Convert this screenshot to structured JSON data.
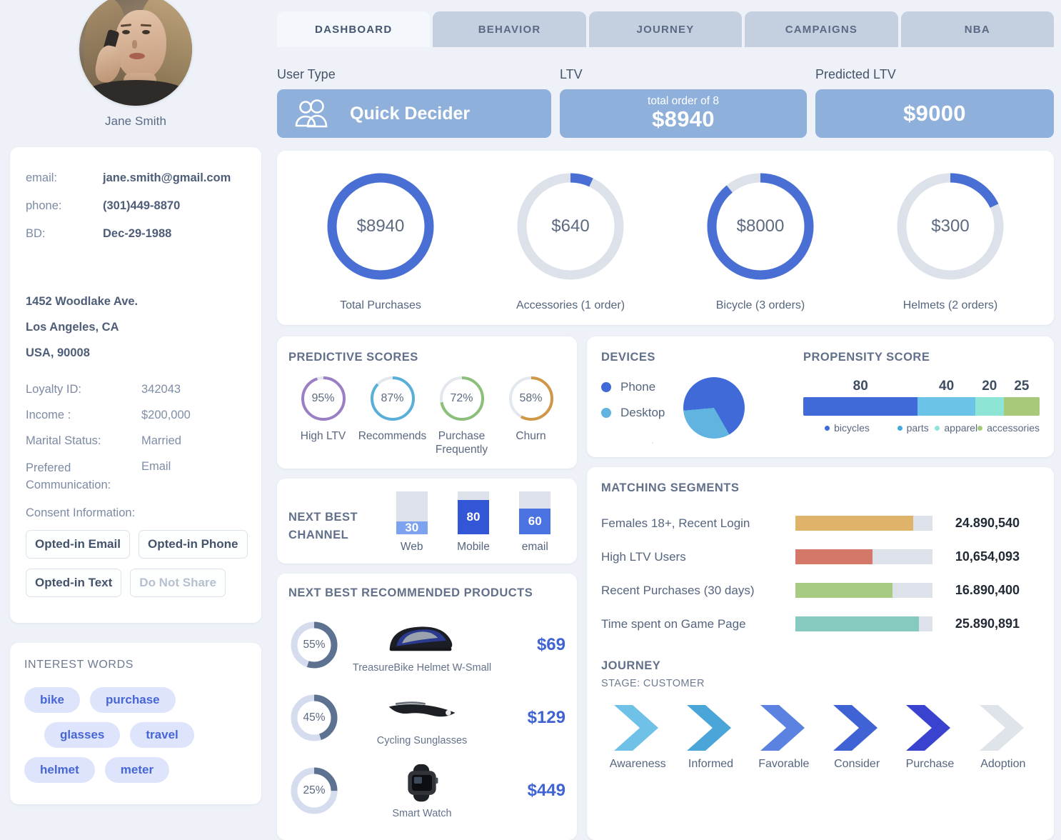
{
  "profile": {
    "name": "Jane Smith",
    "avatar_icon": "user-photo",
    "fields": [
      {
        "label": "email:",
        "value": "jane.smith@gmail.com"
      },
      {
        "label": "phone:",
        "value": "(301)449-8870"
      },
      {
        "label": "BD:",
        "value": "Dec-29-1988"
      }
    ],
    "address": [
      "1452 Woodlake Ave.",
      "Los Angeles, CA",
      "USA, 90008"
    ],
    "details": [
      {
        "label": "Loyalty ID:",
        "value": "342043"
      },
      {
        "label": "Income :",
        "value": "$200,000"
      },
      {
        "label": "Marital Status:",
        "value": "Married"
      },
      {
        "label": "Prefered Communication:",
        "value": "Email"
      }
    ],
    "consent_label": "Consent Information:",
    "consent_chips": [
      {
        "label": "Opted-in Email",
        "active": true
      },
      {
        "label": "Opted-in Phone",
        "active": true
      },
      {
        "label": "Opted-in Text",
        "active": true
      },
      {
        "label": "Do Not Share",
        "active": false
      }
    ]
  },
  "interest_words": {
    "title": "INTEREST WORDS",
    "rows": [
      [
        "bike",
        "purchase"
      ],
      [
        "glasses",
        "travel"
      ],
      [
        "helmet",
        "meter"
      ]
    ]
  },
  "tabs": [
    {
      "label": "DASHBOARD",
      "active": true
    },
    {
      "label": "BEHAVIOR",
      "active": false
    },
    {
      "label": "JOURNEY",
      "active": false
    },
    {
      "label": "CAMPAIGNS",
      "active": false
    },
    {
      "label": "NBA",
      "active": false
    }
  ],
  "kpis": {
    "user_type": {
      "label": "User Type",
      "value": "Quick Decider",
      "icon": "people-icon"
    },
    "ltv": {
      "label": "LTV",
      "sub": "total order of 8",
      "value": "$8940"
    },
    "predicted_ltv": {
      "label": "Predicted LTV",
      "value": "$9000"
    }
  },
  "chart_data": [
    {
      "type": "pie",
      "title": "Purchase Breakdown Donuts",
      "series": [
        {
          "name": "Total Purchases",
          "display": "$8940",
          "percent": 100
        },
        {
          "name": "Accessories (1 order)",
          "display": "$640",
          "percent": 7
        },
        {
          "name": "Bicycle (3 orders)",
          "display": "$8000",
          "percent": 89
        },
        {
          "name": "Helmets (2 orders)",
          "display": "$300",
          "percent": 18
        }
      ],
      "colors": {
        "fill": "#4a6fd4",
        "track": "#dde2ea"
      }
    },
    {
      "type": "pie",
      "title": "PREDICTIVE SCORES",
      "series": [
        {
          "name": "High LTV",
          "display": "95%",
          "percent": 95,
          "color": "#9b7fc4"
        },
        {
          "name": "Recommends",
          "display": "87%",
          "percent": 87,
          "color": "#5aafd9"
        },
        {
          "name": "Purchase Frequently",
          "display": "72%",
          "percent": 72,
          "color": "#8cbf7a"
        },
        {
          "name": "Churn",
          "display": "58%",
          "percent": 58,
          "color": "#cf9748"
        }
      ]
    },
    {
      "type": "bar",
      "title": "NEXT BEST CHANNEL",
      "categories": [
        "Web",
        "Mobile",
        "email"
      ],
      "values": [
        30,
        80,
        60
      ],
      "ylim": [
        0,
        100
      ],
      "colors": [
        "#7da2f0",
        "#3256d6",
        "#4a72e0"
      ],
      "track_color": "#dde1e9"
    },
    {
      "type": "pie",
      "title": "DEVICES",
      "categories": [
        "Phone",
        "Desktop"
      ],
      "values": [
        68,
        32
      ],
      "colors": [
        "#3f6ad8",
        "#62b4e0"
      ],
      "legend": "left"
    },
    {
      "type": "bar",
      "title": "PROPENSITY SCORE",
      "categories": [
        "bicycles",
        "parts",
        "apparel",
        "accessories"
      ],
      "values": [
        80,
        40,
        20,
        25
      ],
      "colors": [
        "#3f6ad8",
        "#6cc3e8",
        "#8ee5d5",
        "#a8c97a"
      ],
      "orientation": "stacked-horizontal"
    },
    {
      "type": "bar",
      "title": "MATCHING SEGMENTS",
      "categories": [
        "Females 18+, Recent Login",
        "High LTV Users",
        "Recent Purchases (30 days)",
        "Time spent on Game Page"
      ],
      "values": [
        24890540,
        10654093,
        16890400,
        25890891
      ],
      "value_labels": [
        "24.890,540",
        "10,654,093",
        "16.890,400",
        "25.890,891"
      ],
      "fill_percents": [
        86,
        56,
        71,
        90
      ],
      "colors": [
        "#dfb36a",
        "#d4796a",
        "#a7cb83",
        "#86c9bf"
      ],
      "track_color": "#dde2ea",
      "orientation": "horizontal"
    }
  ],
  "predictive_scores": {
    "title": "PREDICTIVE SCORES",
    "items": [
      {
        "label": "High LTV",
        "value": "95%",
        "percent": 95,
        "color": "#9b7fc4"
      },
      {
        "label": "Recommends",
        "value": "87%",
        "percent": 87,
        "color": "#5aafd9"
      },
      {
        "label": "Purchase Frequently",
        "value": "72%",
        "percent": 72,
        "color": "#8cbf7a"
      },
      {
        "label": "Churn",
        "value": "58%",
        "percent": 58,
        "color": "#cf9748"
      }
    ]
  },
  "next_best_channel": {
    "title_line1": "NEXT BEST",
    "title_line2": "CHANNEL",
    "items": [
      {
        "label": "Web",
        "value": "30",
        "percent": 30,
        "color": "#7da2f0"
      },
      {
        "label": "Mobile",
        "value": "80",
        "percent": 80,
        "color": "#3256d6"
      },
      {
        "label": "email",
        "value": "60",
        "percent": 60,
        "color": "#4a72e0"
      }
    ]
  },
  "next_best_products": {
    "title": "NEXT BEST RECOMMENDED PRODUCTS",
    "items": [
      {
        "percent": "55%",
        "pct": 55,
        "name": "TreasureBike Helmet W-Small",
        "price": "$69",
        "icon": "helmet-image"
      },
      {
        "percent": "45%",
        "pct": 45,
        "name": "Cycling Sunglasses",
        "price": "$129",
        "icon": "sunglasses-image"
      },
      {
        "percent": "25%",
        "pct": 25,
        "name": "Smart Watch",
        "price": "$449",
        "icon": "smartwatch-image"
      }
    ]
  },
  "devices": {
    "title": "DEVICES",
    "items": [
      {
        "label": "Phone",
        "color": "#3f6ad8",
        "percent": 68
      },
      {
        "label": "Desktop",
        "color": "#62b4e0",
        "percent": 32
      }
    ]
  },
  "propensity": {
    "title": "PROPENSITY SCORE",
    "items": [
      {
        "label": "bicycles",
        "value": "80",
        "percent": 80,
        "color": "#3f6ad8"
      },
      {
        "label": "parts",
        "value": "40",
        "percent": 40,
        "color": "#6cc3e8"
      },
      {
        "label": "apparel",
        "value": "20",
        "percent": 20,
        "color": "#8ee5d5"
      },
      {
        "label": "accessories",
        "value": "25",
        "percent": 25,
        "color": "#a8c97a"
      }
    ]
  },
  "matching_segments": {
    "title": "MATCHING SEGMENTS",
    "items": [
      {
        "name": "Females 18+, Recent Login",
        "value": "24.890,540",
        "percent": 86,
        "color": "#dfb36a"
      },
      {
        "name": "High LTV Users",
        "value": "10,654,093",
        "percent": 56,
        "color": "#d4796a"
      },
      {
        "name": "Recent Purchases (30 days)",
        "value": "16.890,400",
        "percent": 71,
        "color": "#a7cb83"
      },
      {
        "name": "Time spent on Game Page",
        "value": "25.890,891",
        "percent": 90,
        "color": "#86c9bf"
      }
    ]
  },
  "journey": {
    "title": "JOURNEY",
    "stage": "STAGE: CUSTOMER",
    "steps": [
      {
        "label": "Awareness",
        "color": "#6fc1e8"
      },
      {
        "label": "Informed",
        "color": "#4aa6d8"
      },
      {
        "label": "Favorable",
        "color": "#5b82e0"
      },
      {
        "label": "Consider",
        "color": "#3f63d4"
      },
      {
        "label": "Purchase",
        "color": "#3a43cf"
      },
      {
        "label": "Adoption",
        "color": "#dfe3ea"
      }
    ]
  }
}
